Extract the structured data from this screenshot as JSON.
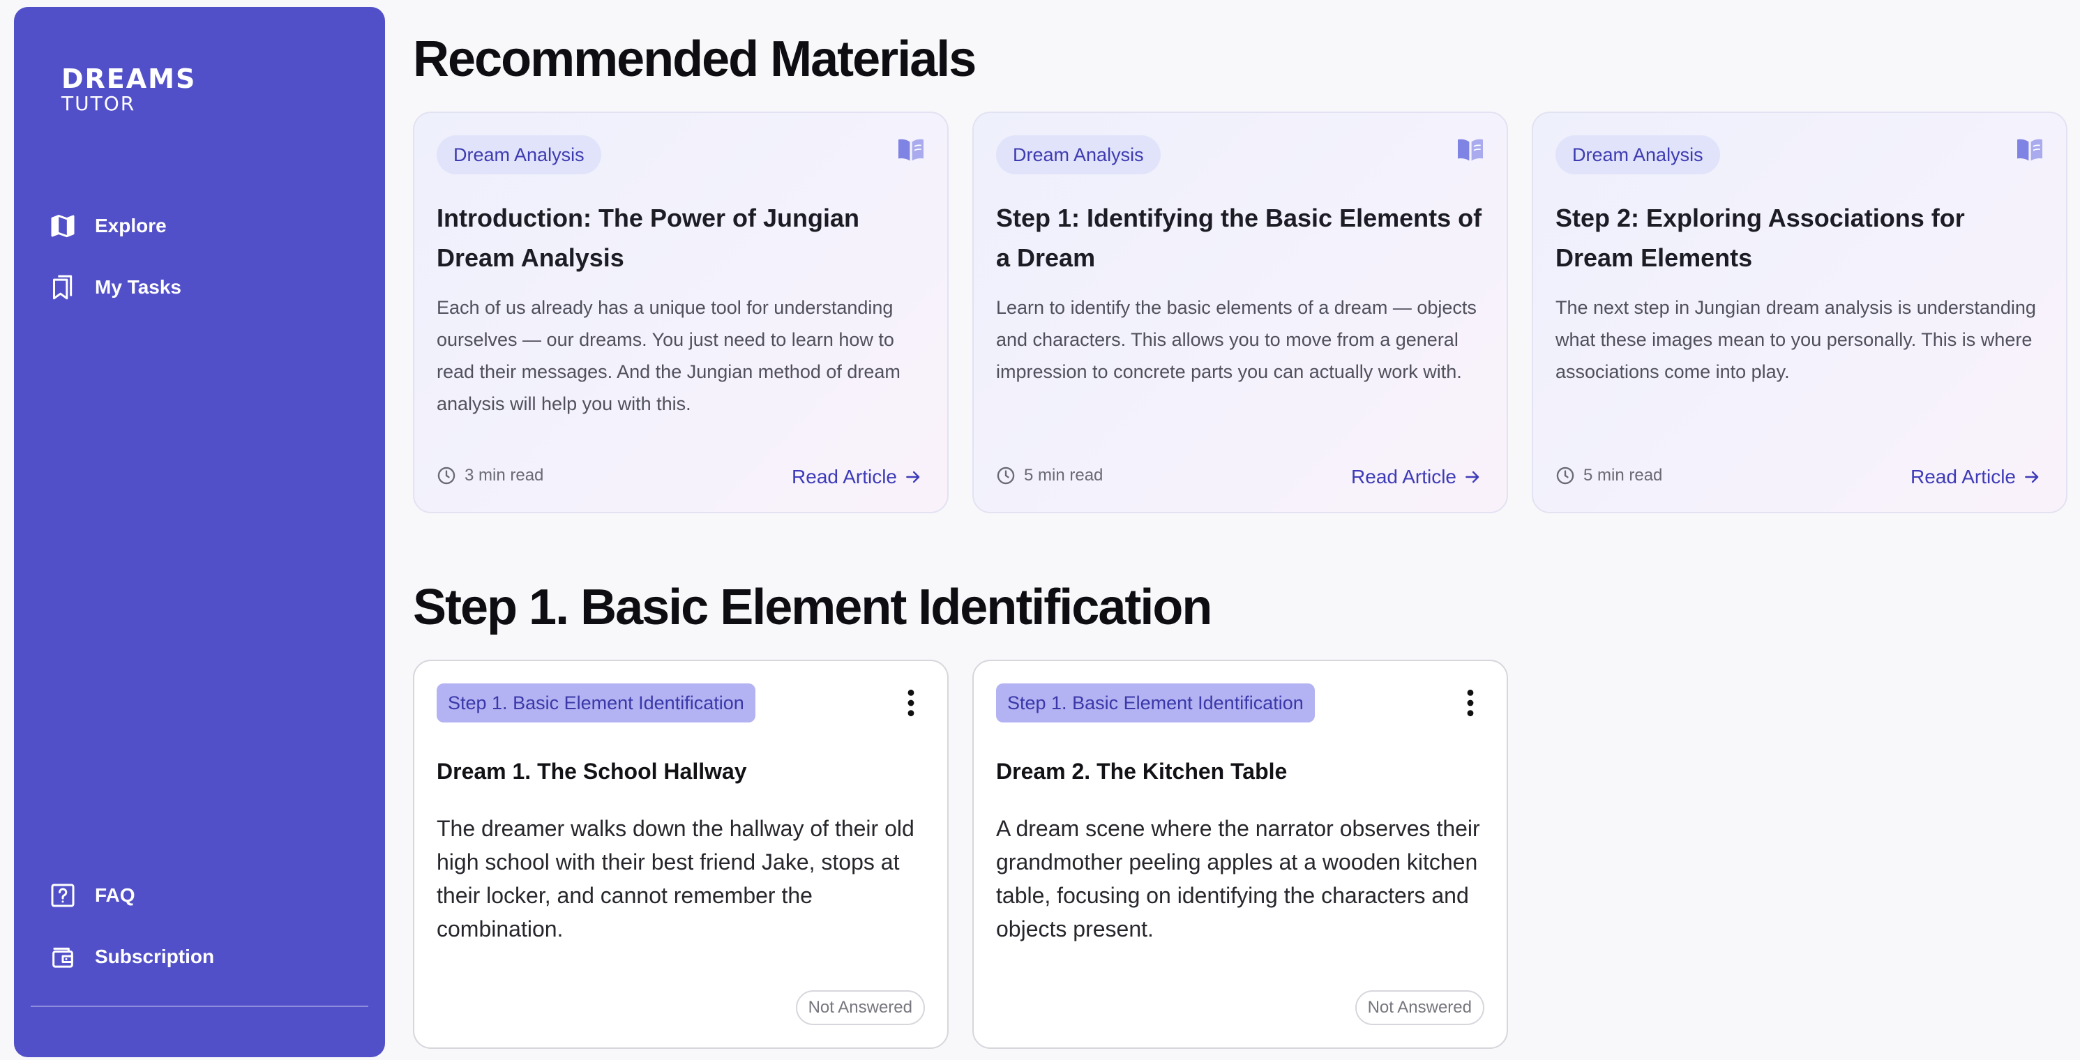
{
  "app": {
    "logo_top": "DREAMS",
    "logo_bottom": "TUTOR"
  },
  "sidebar": {
    "top_items": [
      {
        "label": "Explore",
        "icon": "map-icon"
      },
      {
        "label": "My Tasks",
        "icon": "bookmarks-icon"
      }
    ],
    "bottom_items": [
      {
        "label": "FAQ",
        "icon": "help-icon"
      },
      {
        "label": "Subscription",
        "icon": "wallet-icon"
      }
    ]
  },
  "recommended": {
    "title": "Recommended Materials",
    "cards": [
      {
        "tag": "Dream Analysis",
        "title": "Introduction: The Power of Jungian Dream Analysis",
        "description": "Each of us already has a unique tool for understanding ourselves — our dreams. You just need to learn how to read their messages. And the Jungian method of dream analysis will help you with this.",
        "read_time": "3 min read",
        "link": "Read Article"
      },
      {
        "tag": "Dream Analysis",
        "title": "Step 1: Identifying the Basic Elements of a Dream",
        "description": "Learn to identify the basic elements of a dream — objects and characters. This allows you to move from a general impression to concrete parts you can actually work with.",
        "read_time": "5 min read",
        "link": "Read Article"
      },
      {
        "tag": "Dream Analysis",
        "title": "Step 2: Exploring Associations for Dream Elements",
        "description": "The next step in Jungian dream analysis is understanding what these images mean to you personally. This is where associations come into play.",
        "read_time": "5 min read",
        "link": "Read Article"
      }
    ]
  },
  "step1": {
    "title": "Step 1. Basic Element Identification",
    "tasks": [
      {
        "tag": "Step 1. Basic Element Identification",
        "title": "Dream 1. The School Hallway",
        "description": "The dreamer walks down the hallway of their old high school with their best friend Jake, stops at their locker, and cannot remember the combination.",
        "status": "Not Answered"
      },
      {
        "tag": "Step 1. Basic Element Identification",
        "title": "Dream 2. The Kitchen Table",
        "description": "A dream scene where the narrator observes their grandmother peeling apples at a wooden kitchen table, focusing on identifying the characters and objects present.",
        "status": "Not Answered"
      }
    ]
  },
  "colors": {
    "sidebar_bg": "#5250c8",
    "accent": "#3d3bb8",
    "tag_bg": "#e1e3fa",
    "step_tag_bg": "#b3b2f2",
    "page_bg": "#f8f8fa"
  }
}
